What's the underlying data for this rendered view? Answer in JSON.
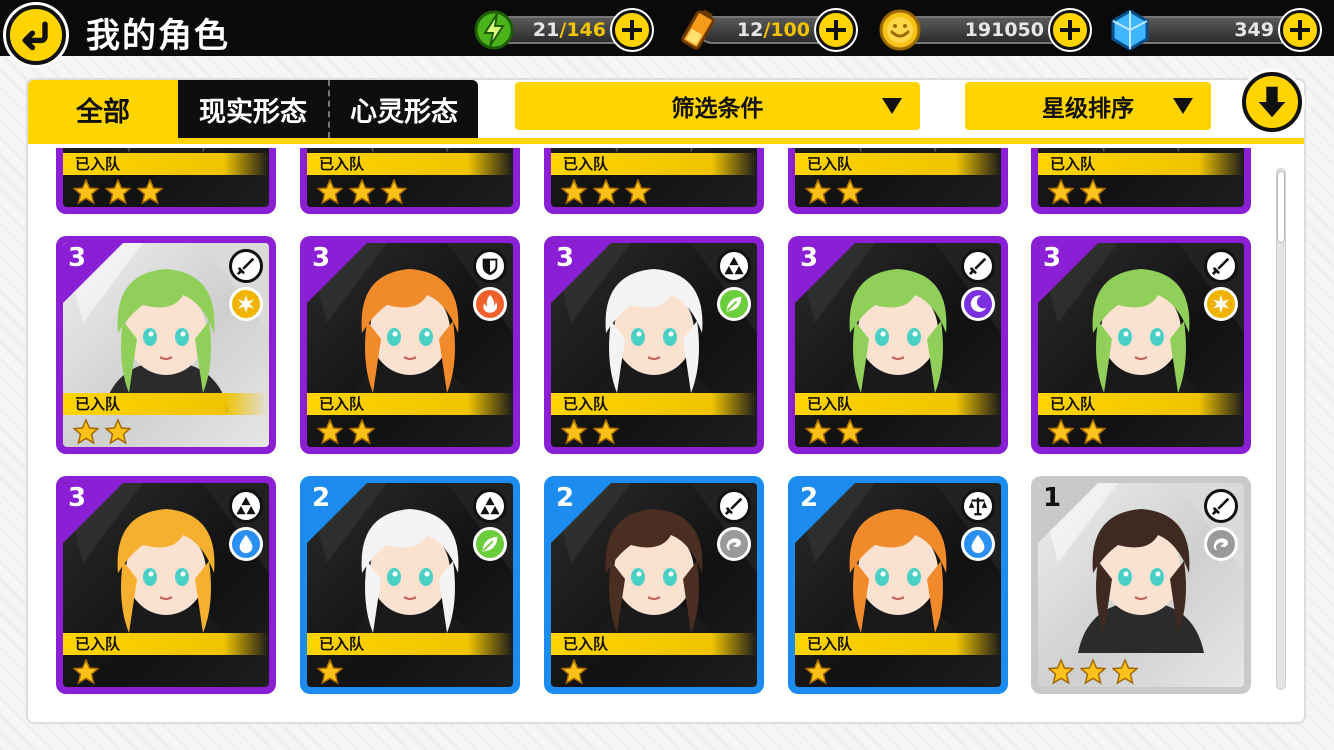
{
  "header": {
    "title": "我的角色",
    "stamina": {
      "current": "21",
      "sep": "/",
      "max": "146"
    },
    "battery": {
      "current": "12",
      "sep": "/",
      "max": "100"
    },
    "coins": "191050",
    "crystals": "349"
  },
  "tabs": [
    "全部",
    "现实形态",
    "心灵形态"
  ],
  "filter_label": "筛选条件",
  "sort_label": "星级排序",
  "colors": {
    "accent": "#ffd400",
    "rank3": "#8a1fd6",
    "rank2": "#1c8cf0",
    "rank1": "#c9c9c9",
    "elem_light": "#f0b400",
    "elem_fire": "#f0602a",
    "elem_wind": "#6ccd3c",
    "elem_dark": "#7a2fe0",
    "elem_water": "#2a8ff0",
    "elem_neutral": "#9a9a9a"
  },
  "cards_top_partial": [
    {
      "joined": "已入队",
      "stars": 3,
      "rarity": "r3"
    },
    {
      "joined": "已入队",
      "stars": 3,
      "rarity": "r3"
    },
    {
      "joined": "已入队",
      "stars": 3,
      "rarity": "r3"
    },
    {
      "joined": "已入队",
      "stars": 2,
      "rarity": "r3"
    },
    {
      "joined": "已入队",
      "stars": 2,
      "rarity": "r3"
    }
  ],
  "cards": [
    {
      "rank": "3",
      "rarity": "r3",
      "type": "sword-icon",
      "element": "light-icon",
      "joined": "已入队",
      "stars": 2,
      "light": true,
      "hair": "#8fcf5a"
    },
    {
      "rank": "3",
      "rarity": "r3",
      "type": "shield-icon",
      "element": "fire-icon",
      "joined": "已入队",
      "stars": 2,
      "light": false,
      "hair": "#f08a2a"
    },
    {
      "rank": "3",
      "rarity": "r3",
      "type": "triforce-icon",
      "element": "leaf-icon",
      "joined": "已入队",
      "stars": 2,
      "light": false,
      "hair": "#f4f4f4"
    },
    {
      "rank": "3",
      "rarity": "r3",
      "type": "sword-icon",
      "element": "moon-icon",
      "joined": "已入队",
      "stars": 2,
      "light": false,
      "hair": "#8fcf5a"
    },
    {
      "rank": "3",
      "rarity": "r3",
      "type": "sword-icon",
      "element": "light-icon",
      "joined": "已入队",
      "stars": 2,
      "light": false,
      "hair": "#8fcf5a"
    },
    {
      "rank": "3",
      "rarity": "r3",
      "type": "triforce-icon",
      "element": "water-icon",
      "joined": "已入队",
      "stars": 1,
      "light": false,
      "hair": "#f5b030"
    },
    {
      "rank": "2",
      "rarity": "r2",
      "type": "triforce-icon",
      "element": "leaf-icon",
      "joined": "已入队",
      "stars": 1,
      "light": false,
      "hair": "#f4f4f4"
    },
    {
      "rank": "2",
      "rarity": "r2",
      "type": "sword-icon",
      "element": "swirl-icon",
      "joined": "已入队",
      "stars": 1,
      "light": false,
      "hair": "#4a2e22"
    },
    {
      "rank": "2",
      "rarity": "r2",
      "type": "scales-icon",
      "element": "water-icon",
      "joined": "已入队",
      "stars": 1,
      "light": false,
      "hair": "#f08a2a"
    },
    {
      "rank": "1",
      "rarity": "r1",
      "type": "sword-icon",
      "element": "swirl-icon",
      "joined": "",
      "stars": 3,
      "light": true,
      "hair": "#3e2a20"
    }
  ]
}
